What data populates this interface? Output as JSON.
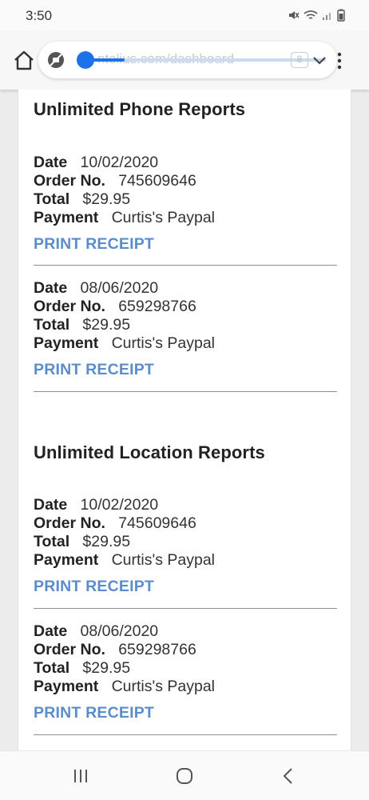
{
  "status_bar": {
    "time": "3:50",
    "icons": [
      "mute-icon",
      "wifi-icon",
      "signal-icon",
      "battery-icon"
    ]
  },
  "browser": {
    "url": "ntelius.com/dashboard",
    "tab_count": "8",
    "page_load_progress": 0.16,
    "icons": [
      "home-icon",
      "incognito-icon",
      "chevron-down-icon",
      "more-vert-icon"
    ],
    "accent_color": "#1a73e8"
  },
  "sections": [
    {
      "title": "Unlimited Phone Reports",
      "orders": [
        {
          "date_label": "Date",
          "date": "10/02/2020",
          "order_label": "Order No.",
          "order_no": "745609646",
          "total_label": "Total",
          "total": "$29.95",
          "payment_label": "Payment",
          "payment": "Curtis's Paypal",
          "print_label": "PRINT RECEIPT"
        },
        {
          "date_label": "Date",
          "date": "08/06/2020",
          "order_label": "Order No.",
          "order_no": "659298766",
          "total_label": "Total",
          "total": "$29.95",
          "payment_label": "Payment",
          "payment": "Curtis's Paypal",
          "print_label": "PRINT RECEIPT"
        }
      ]
    },
    {
      "title": "Unlimited Location Reports",
      "orders": [
        {
          "date_label": "Date",
          "date": "10/02/2020",
          "order_label": "Order No.",
          "order_no": "745609646",
          "total_label": "Total",
          "total": "$29.95",
          "payment_label": "Payment",
          "payment": "Curtis's Paypal",
          "print_label": "PRINT RECEIPT"
        },
        {
          "date_label": "Date",
          "date": "08/06/2020",
          "order_label": "Order No.",
          "order_no": "659298766",
          "total_label": "Total",
          "total": "$29.95",
          "payment_label": "Payment",
          "payment": "Curtis's Paypal",
          "print_label": "PRINT RECEIPT"
        }
      ]
    }
  ],
  "link_color": "#5b8ccc",
  "nav_bar": {
    "icons": [
      "recent-apps-icon",
      "home-circle-icon",
      "back-icon"
    ]
  }
}
